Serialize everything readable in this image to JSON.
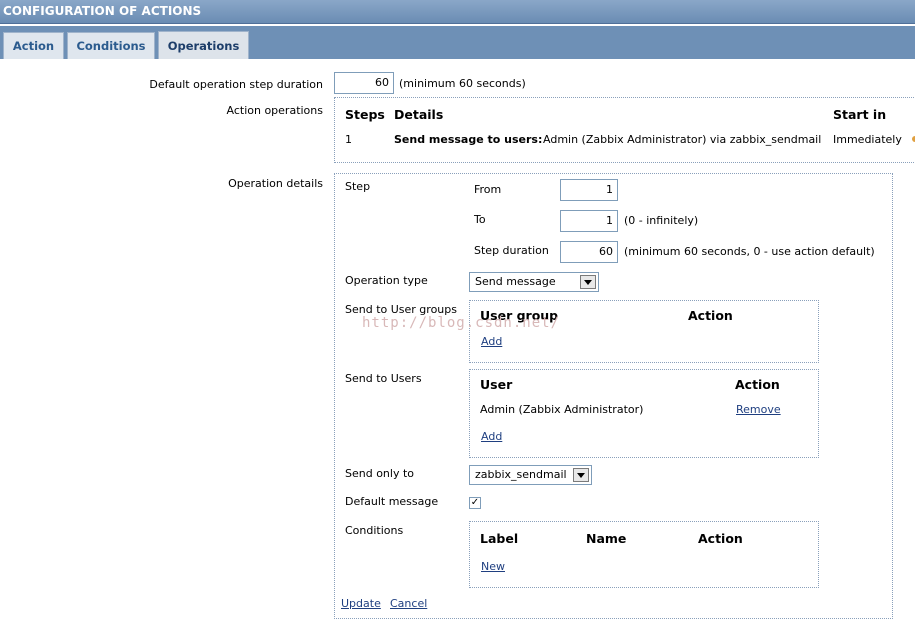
{
  "header": {
    "title": "CONFIGURATION OF ACTIONS"
  },
  "tabs": [
    {
      "label": "Action"
    },
    {
      "label": "Conditions"
    },
    {
      "label": "Operations"
    }
  ],
  "default_step": {
    "label": "Default operation step duration",
    "value": "60",
    "hint": "(minimum 60 seconds)"
  },
  "action_operations": {
    "label": "Action operations",
    "headers": {
      "steps": "Steps",
      "details": "Details",
      "start_in": "Start in"
    },
    "row": {
      "step": "1",
      "details_bold": "Send message to users:",
      "details_rest": "Admin (Zabbix Administrator) via zabbix_sendmail",
      "start_in": "Immediately"
    }
  },
  "operation_details": {
    "label": "Operation details",
    "step_label": "Step",
    "from_label": "From",
    "from_value": "1",
    "to_label": "To",
    "to_value": "1",
    "to_hint": "(0 - infinitely)",
    "duration_label": "Step duration",
    "duration_value": "60",
    "duration_hint": "(minimum 60 seconds, 0 - use action default)",
    "op_type_label": "Operation type",
    "op_type_value": "Send message",
    "user_groups_label": "Send to User groups",
    "user_groups_headers": {
      "group": "User group",
      "action": "Action"
    },
    "user_groups_add": "Add",
    "users_label": "Send to Users",
    "users_headers": {
      "user": "User",
      "action": "Action"
    },
    "users_row": {
      "name": "Admin (Zabbix Administrator)",
      "action": "Remove"
    },
    "users_add": "Add",
    "send_only_label": "Send only to",
    "send_only_value": "zabbix_sendmail",
    "default_msg_label": "Default message",
    "default_msg_checked": "✓",
    "conditions_label": "Conditions",
    "conditions_headers": {
      "label": "Label",
      "name": "Name",
      "action": "Action"
    },
    "conditions_new": "New",
    "update": "Update",
    "cancel": "Cancel"
  },
  "watermark": "http://blog.csdn.net/"
}
